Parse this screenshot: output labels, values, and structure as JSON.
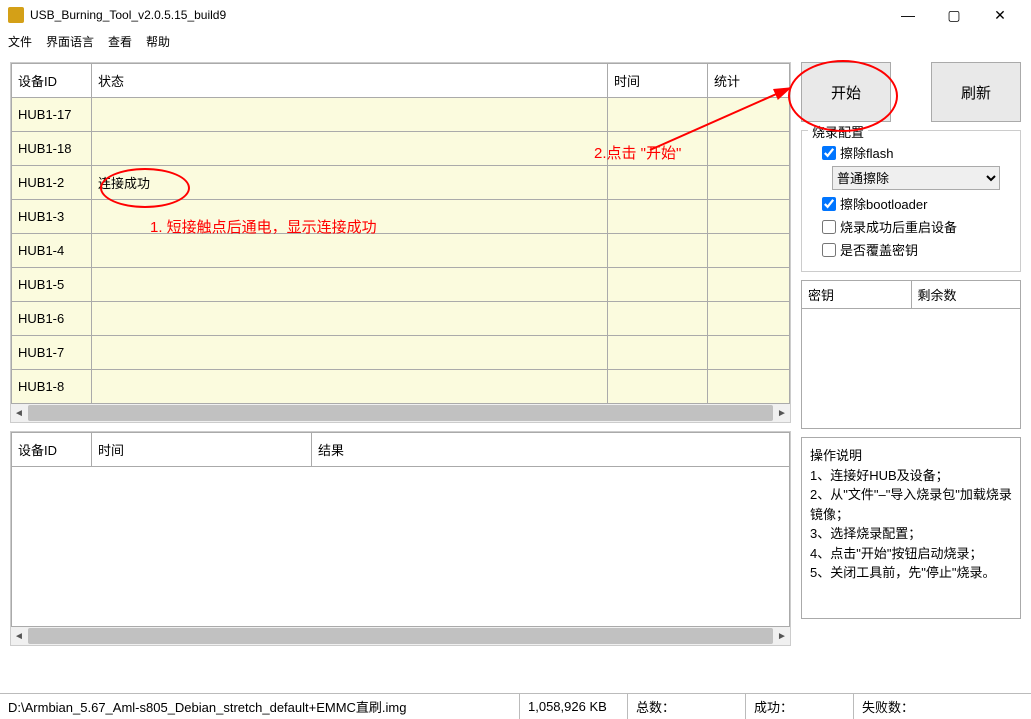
{
  "window": {
    "title": "USB_Burning_Tool_v2.0.5.15_build9"
  },
  "menu": {
    "file": "文件",
    "lang": "界面语言",
    "view": "查看",
    "help": "帮助"
  },
  "devTable": {
    "cols": {
      "id": "设备ID",
      "status": "状态",
      "time": "时间",
      "stats": "统计"
    },
    "rows": [
      {
        "id": "HUB1-17",
        "status": "",
        "time": "",
        "stats": ""
      },
      {
        "id": "HUB1-18",
        "status": "",
        "time": "",
        "stats": ""
      },
      {
        "id": "HUB1-2",
        "status": "连接成功",
        "time": "",
        "stats": ""
      },
      {
        "id": "HUB1-3",
        "status": "",
        "time": "",
        "stats": ""
      },
      {
        "id": "HUB1-4",
        "status": "",
        "time": "",
        "stats": ""
      },
      {
        "id": "HUB1-5",
        "status": "",
        "time": "",
        "stats": ""
      },
      {
        "id": "HUB1-6",
        "status": "",
        "time": "",
        "stats": ""
      },
      {
        "id": "HUB1-7",
        "status": "",
        "time": "",
        "stats": ""
      },
      {
        "id": "HUB1-8",
        "status": "",
        "time": "",
        "stats": ""
      }
    ]
  },
  "resTable": {
    "cols": {
      "id": "设备ID",
      "time": "时间",
      "result": "结果"
    }
  },
  "buttons": {
    "start": "开始",
    "refresh": "刷新"
  },
  "config": {
    "title": "烧录配置",
    "eraseFlash": "擦除flash",
    "eraseMode": "普通擦除",
    "eraseBootloader": "擦除bootloader",
    "rebootAfter": "烧录成功后重启设备",
    "overwriteKey": "是否覆盖密钥"
  },
  "keyTable": {
    "key": "密钥",
    "remain": "剩余数"
  },
  "instr": {
    "title": "操作说明",
    "l1": "1、连接好HUB及设备；",
    "l2": "2、从\"文件\"–\"导入烧录包\"加载烧录镜像；",
    "l3": "3、选择烧录配置；",
    "l4": "4、点击\"开始\"按钮启动烧录；",
    "l5": "5、关闭工具前，先\"停止\"烧录。"
  },
  "status": {
    "path": "D:\\Armbian_5.67_Aml-s805_Debian_stretch_default+EMMC直刷.img",
    "size": "1,058,926 KB",
    "total": "总数：",
    "success": "成功：",
    "fail": "失败数："
  },
  "annotations": {
    "a1": "1. 短接触点后通电，显示连接成功",
    "a2": "2.点击 \"开始\""
  }
}
